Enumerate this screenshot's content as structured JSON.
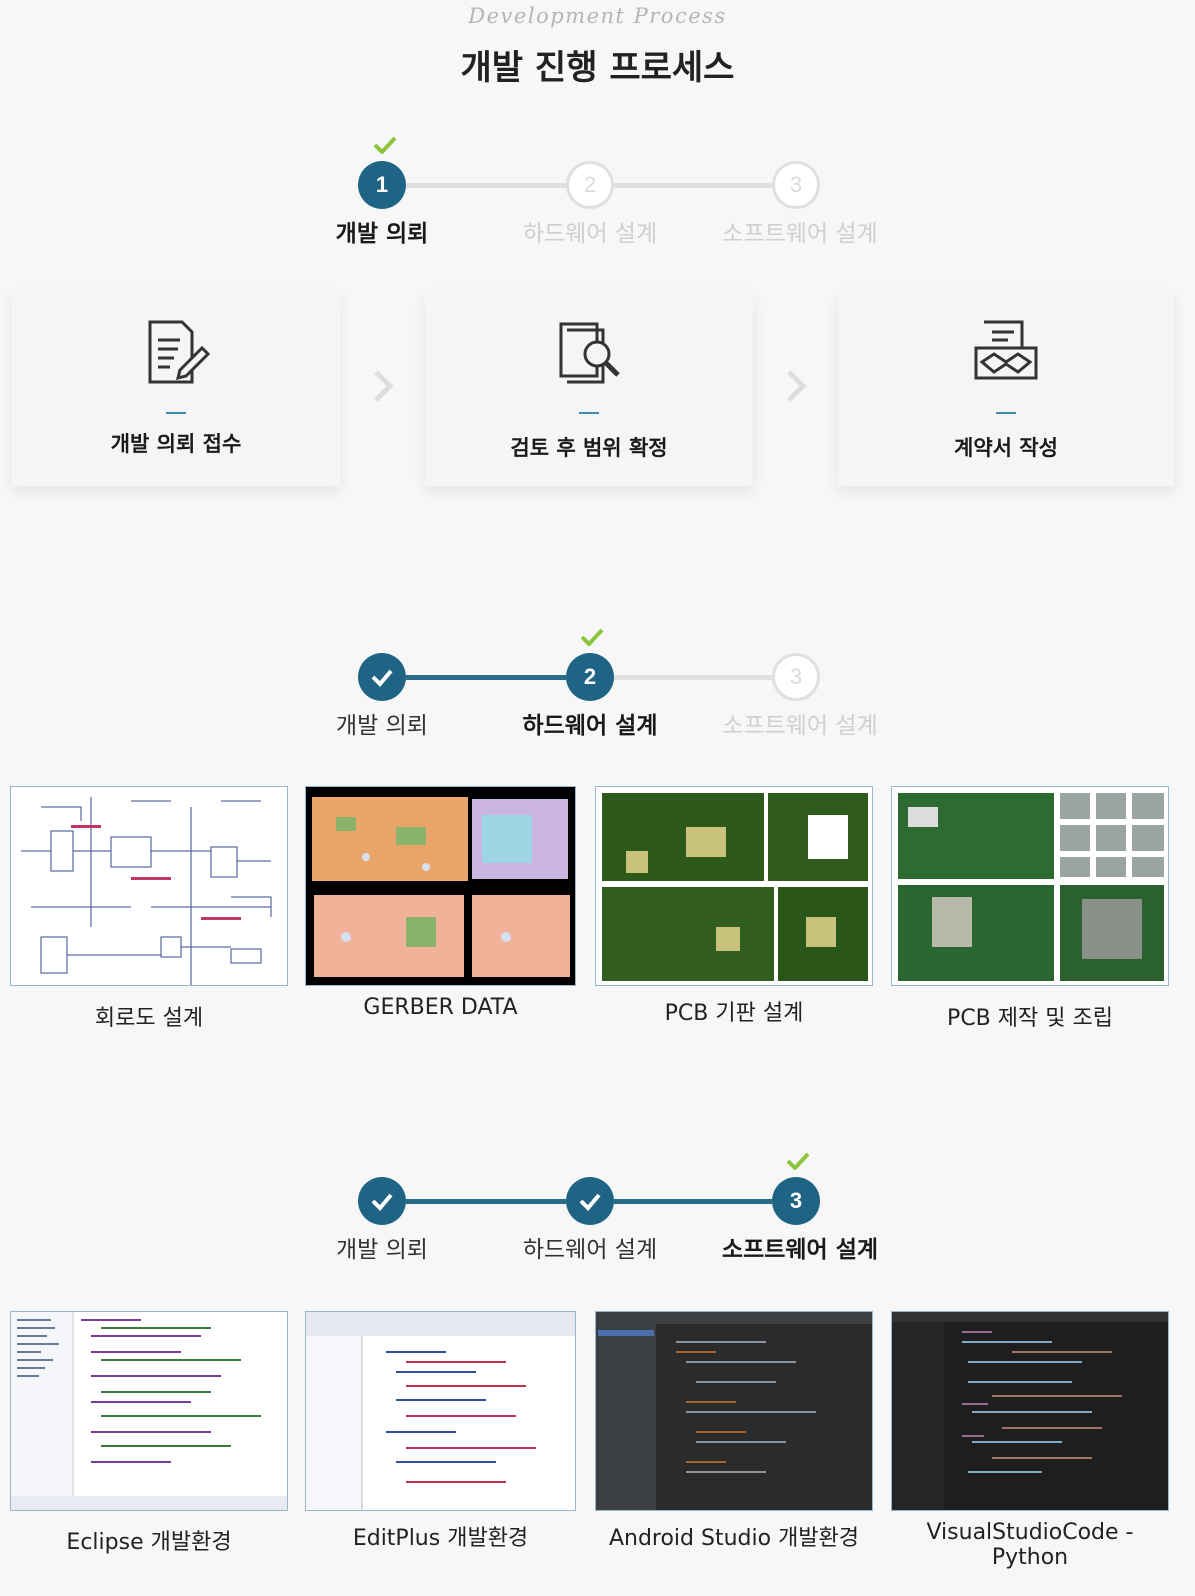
{
  "header": {
    "script_title": "Development Process",
    "title": "개발 진행 프로세스"
  },
  "steps": [
    "개발 의뢰",
    "하드웨어 설계",
    "소프트웨어 설계"
  ],
  "step_numbers": [
    "1",
    "2",
    "3"
  ],
  "section1": {
    "cards": [
      {
        "title": "개발 의뢰 접수",
        "icon": "document-edit-icon"
      },
      {
        "title": "검토 후 범위 확정",
        "icon": "document-search-icon"
      },
      {
        "title": "계약서 작성",
        "icon": "contract-handshake-icon"
      }
    ]
  },
  "section2": {
    "items": [
      {
        "caption": "회로도 설계"
      },
      {
        "caption": "GERBER DATA"
      },
      {
        "caption": "PCB 기판 설계"
      },
      {
        "caption": "PCB 제작 및 조립"
      }
    ]
  },
  "section3": {
    "items": [
      {
        "caption": "Eclipse 개발환경"
      },
      {
        "caption": "EditPlus 개발환경"
      },
      {
        "caption": "Android Studio 개발환경"
      },
      {
        "caption": "VisualStudioCode - Python"
      }
    ]
  },
  "colors": {
    "accent": "#1f6485",
    "check": "#8cc63f",
    "pending": "#e0e0e0"
  }
}
